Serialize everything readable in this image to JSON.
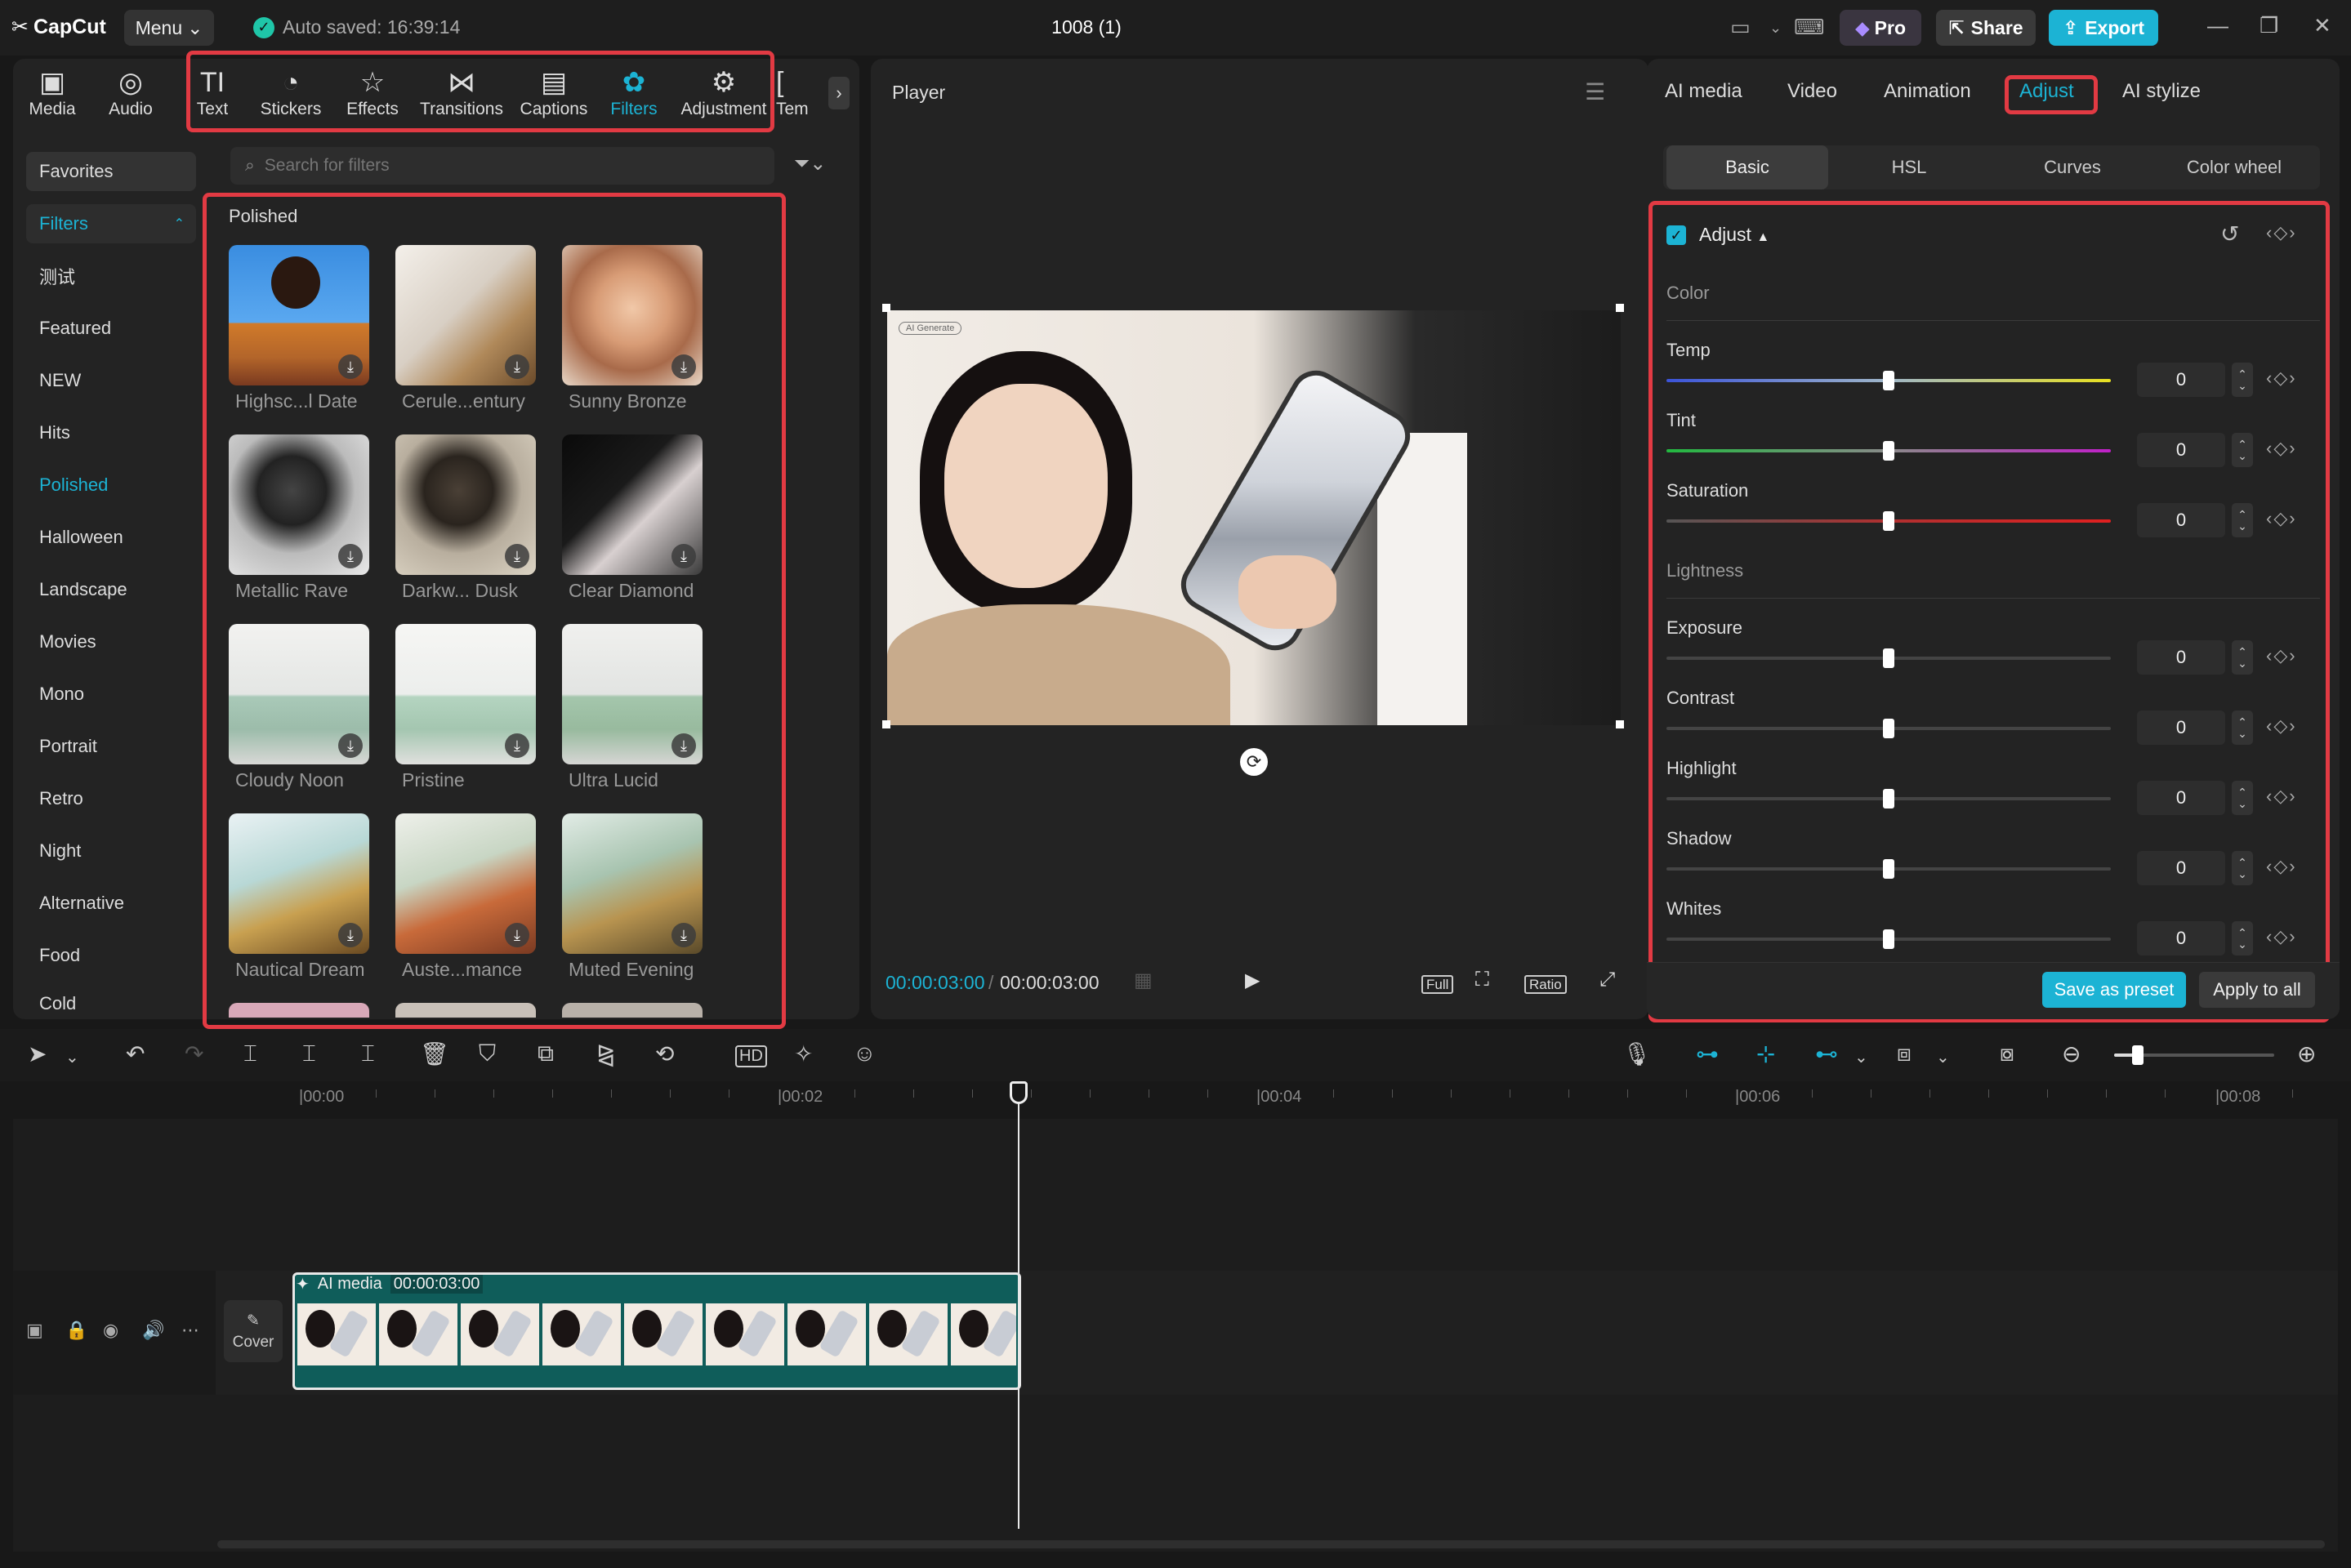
{
  "titlebar": {
    "app_name": "CapCut",
    "menu_label": "Menu",
    "autosave_text": "Auto saved: 16:39:14",
    "project_title": "1008 (1)",
    "pro_label": "Pro",
    "share_label": "Share",
    "export_label": "Export"
  },
  "toolbar": {
    "tools": [
      {
        "label": "Media",
        "icon": "media-icon"
      },
      {
        "label": "Audio",
        "icon": "audio-icon"
      },
      {
        "label": "Text",
        "icon": "text-icon"
      },
      {
        "label": "Stickers",
        "icon": "stickers-icon"
      },
      {
        "label": "Effects",
        "icon": "effects-icon"
      },
      {
        "label": "Transitions",
        "icon": "transitions-icon"
      },
      {
        "label": "Captions",
        "icon": "captions-icon"
      },
      {
        "label": "Filters",
        "icon": "filters-icon"
      },
      {
        "label": "Adjustment",
        "icon": "adjustment-icon"
      },
      {
        "label": "Tem",
        "icon": "templates-icon"
      }
    ],
    "active_tool": "Filters"
  },
  "filters_panel": {
    "search_placeholder": "Search for filters",
    "categories": [
      "Favorites",
      "Filters",
      "测试",
      "Featured",
      "NEW",
      "Hits",
      "Polished",
      "Halloween",
      "Landscape",
      "Movies",
      "Mono",
      "Portrait",
      "Retro",
      "Night",
      "Alternative",
      "Food",
      "Cold"
    ],
    "active_category": "Polished",
    "section_title": "Polished",
    "filters": [
      "Highsc...l Date",
      "Cerule...entury",
      "Sunny Bronze",
      "Metallic Rave",
      "Darkw... Dusk",
      "Clear Diamond",
      "Cloudy Noon",
      "Pristine",
      "Ultra Lucid",
      "Nautical Dream",
      "Auste...mance",
      "Muted Evening"
    ]
  },
  "player": {
    "title": "Player",
    "badge": "AI Generate",
    "current_time": "00:00:03:00",
    "total_time": "00:00:03:00",
    "full_label": "Full",
    "ratio_label": "Ratio"
  },
  "right_panel": {
    "tabs": [
      "AI media",
      "Video",
      "Animation",
      "Adjust",
      "AI stylize"
    ],
    "active_tab": "Adjust",
    "subtabs": [
      "Basic",
      "HSL",
      "Curves",
      "Color wheel"
    ],
    "active_subtab": "Basic",
    "section_title": "Adjust",
    "color_group": "Color",
    "lightness_group": "Lightness",
    "params": [
      {
        "label": "Temp",
        "value": "0"
      },
      {
        "label": "Tint",
        "value": "0"
      },
      {
        "label": "Saturation",
        "value": "0"
      },
      {
        "label": "Exposure",
        "value": "0"
      },
      {
        "label": "Contrast",
        "value": "0"
      },
      {
        "label": "Highlight",
        "value": "0"
      },
      {
        "label": "Shadow",
        "value": "0"
      },
      {
        "label": "Whites",
        "value": "0"
      }
    ],
    "save_preset_label": "Save as preset",
    "apply_all_label": "Apply to all"
  },
  "timeline": {
    "ruler_labels": [
      "00:00",
      "00:02",
      "00:04",
      "00:06",
      "00:08"
    ],
    "cover_label": "Cover",
    "clip_label": "AI media",
    "clip_duration": "00:00:03:00"
  }
}
